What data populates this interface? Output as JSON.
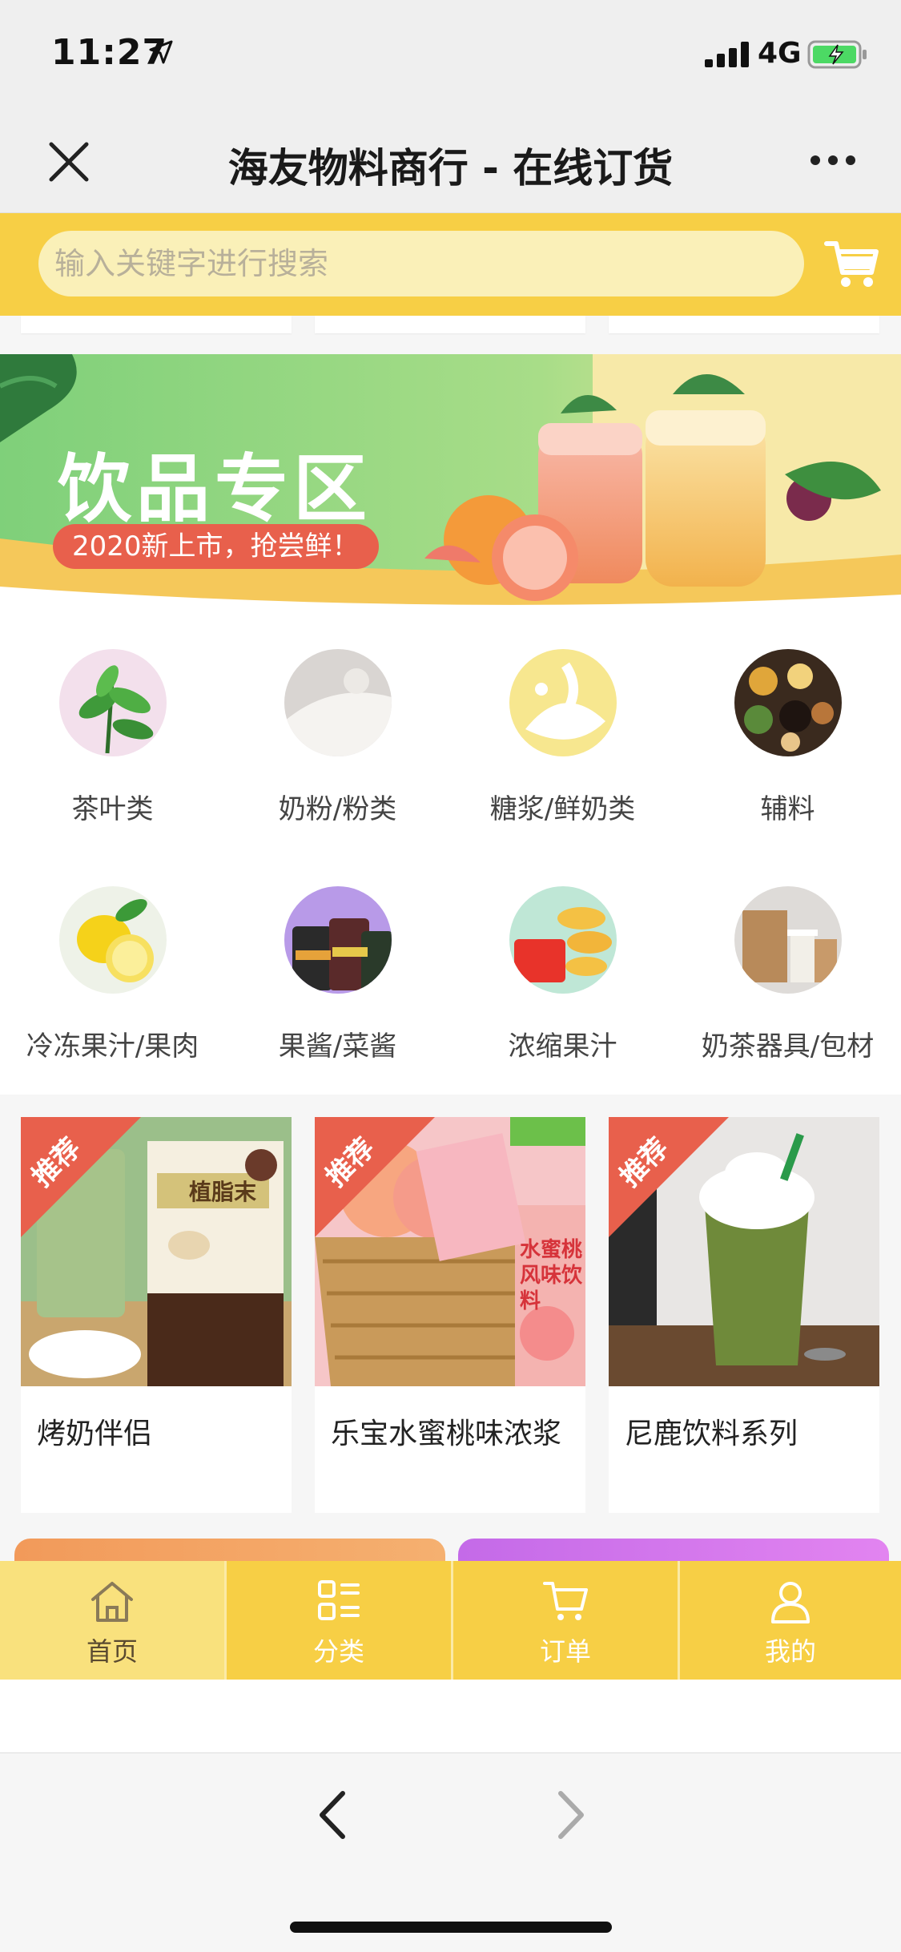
{
  "status_bar": {
    "time": "11:27",
    "network": "4G"
  },
  "nav": {
    "title": "海友物料商行 - 在线订货"
  },
  "search": {
    "placeholder": "输入关键字进行搜索"
  },
  "banner": {
    "title": "饮品专区",
    "subtitle": "2020新上市，抢尝鲜！"
  },
  "categories": [
    {
      "label": "茶叶类",
      "icon": "tea-leaf-icon"
    },
    {
      "label": "奶粉/粉类",
      "icon": "milk-powder-icon"
    },
    {
      "label": "糖浆/鲜奶类",
      "icon": "syrup-milk-icon"
    },
    {
      "label": "辅料",
      "icon": "ingredients-icon"
    },
    {
      "label": "冷冻果汁/果肉",
      "icon": "lemon-icon"
    },
    {
      "label": "果酱/菜酱",
      "icon": "jam-jar-icon"
    },
    {
      "label": "浓缩果汁",
      "icon": "juice-concentrate-icon"
    },
    {
      "label": "奶茶器具/包材",
      "icon": "cup-package-icon"
    }
  ],
  "products": [
    {
      "tag": "推荐",
      "name": "烤奶伴侣",
      "pack_text": "植脂末"
    },
    {
      "tag": "推荐",
      "name": "乐宝水蜜桃味浓浆",
      "pack_text": "水蜜桃风味饮料"
    },
    {
      "tag": "推荐",
      "name": "尼鹿饮料系列"
    }
  ],
  "tabs": [
    {
      "label": "首页",
      "icon": "home-icon"
    },
    {
      "label": "分类",
      "icon": "category-icon"
    },
    {
      "label": "订单",
      "icon": "cart-icon"
    },
    {
      "label": "我的",
      "icon": "user-icon"
    }
  ],
  "colors": {
    "accent": "#f7cf45",
    "tag_red": "#e8604c",
    "banner_green": "#7fd07a"
  }
}
